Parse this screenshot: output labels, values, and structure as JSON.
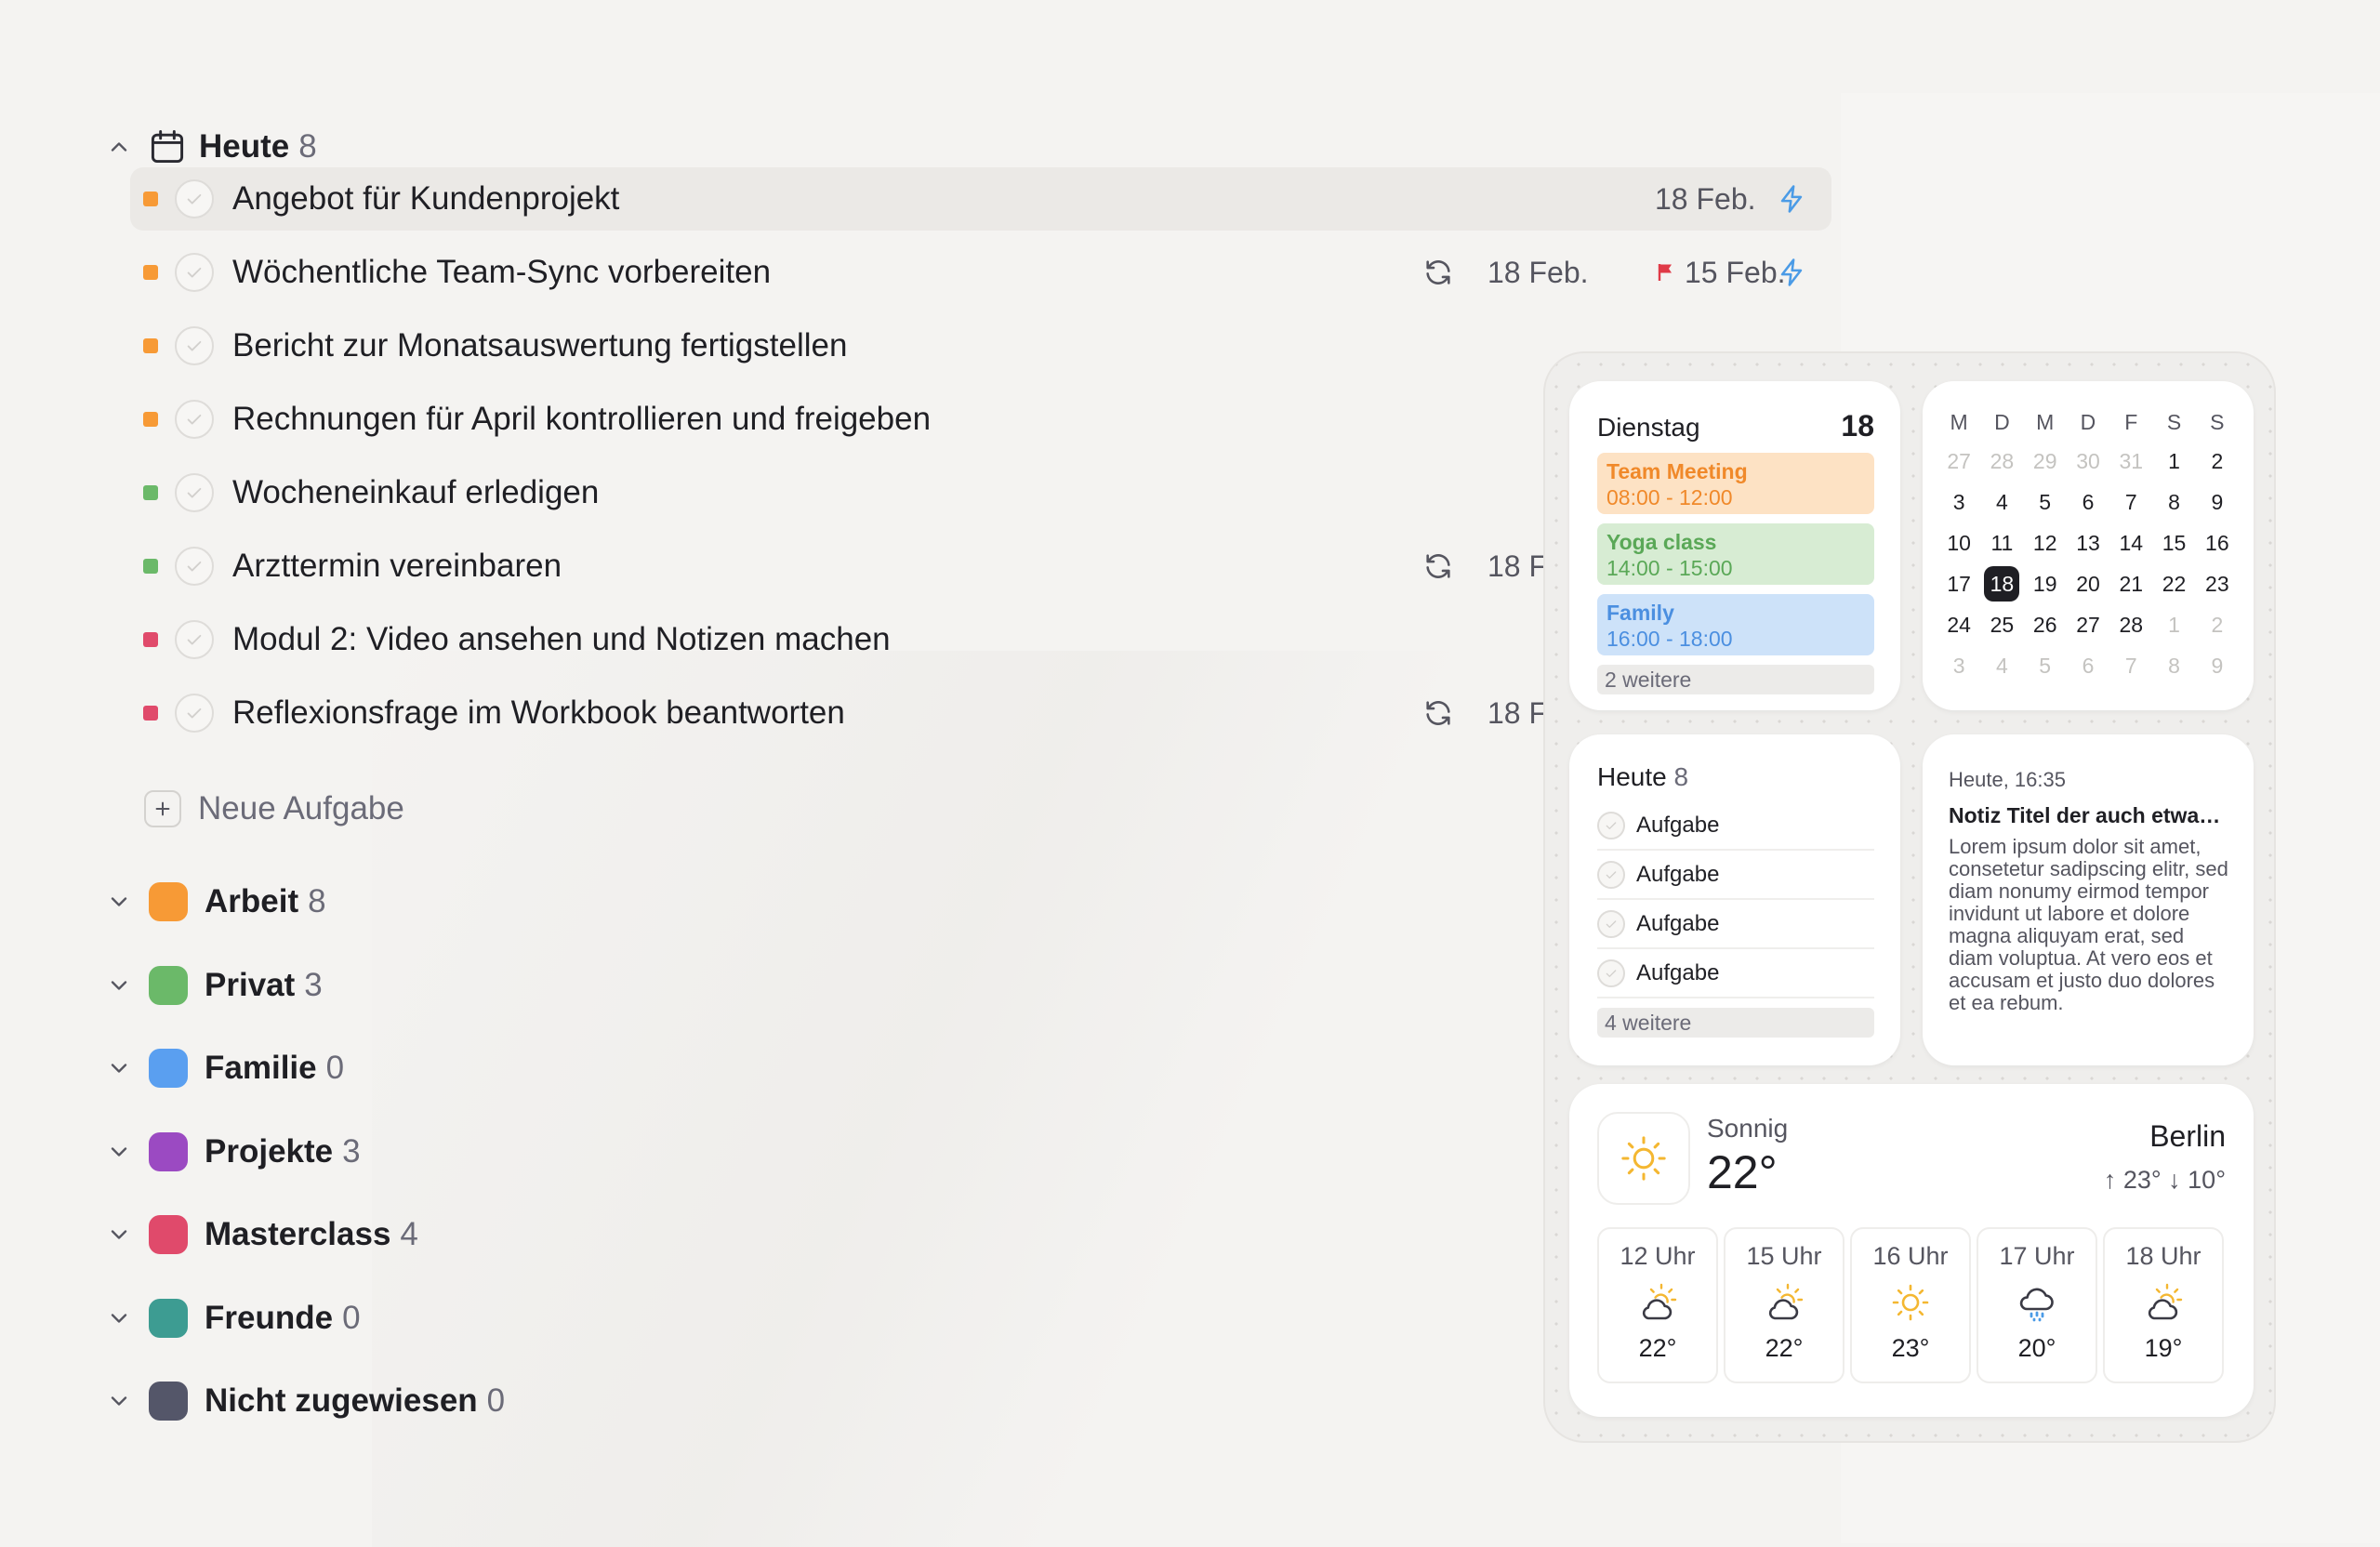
{
  "colors": {
    "orange": "#f79a36",
    "green": "#6bb969",
    "blue": "#5a9ff0",
    "purple": "#9b4ac2",
    "red": "#e04a6b",
    "teal": "#3d9c92",
    "slate": "#545669",
    "lightning": "#4b9be6",
    "flag": "#e03a47"
  },
  "today_group": {
    "title": "Heute",
    "count": "8",
    "tasks": [
      {
        "title": "Angebot für Kundenprojekt",
        "priority": "orange",
        "date": "18 Feb.",
        "icon": "lightning-icon"
      },
      {
        "title": "Wöchentliche Team-Sync vorbereiten",
        "priority": "orange",
        "repeat": true,
        "date": "18 Feb.",
        "deadline": "15 Feb.",
        "icon": "lightning-icon"
      },
      {
        "title": "Bericht zur Monatsauswertung fertigstellen",
        "priority": "orange"
      },
      {
        "title": "Rechnungen für April kontrollieren und freigeben",
        "priority": "orange"
      },
      {
        "title": "Wocheneinkauf erledigen",
        "priority": "green"
      },
      {
        "title": "Arzttermin vereinbaren",
        "priority": "green",
        "repeat": true,
        "date": "18 F"
      },
      {
        "title": "Modul 2: Video ansehen und Notizen machen",
        "priority": "red"
      },
      {
        "title": "Reflexionsfrage im Workbook beantworten",
        "priority": "red",
        "repeat": true,
        "date": "18 F"
      }
    ],
    "new_task_label": "Neue Aufgabe"
  },
  "groups": [
    {
      "title": "Arbeit",
      "count": "8",
      "color": "#f79a36"
    },
    {
      "title": "Privat",
      "count": "3",
      "color": "#6bb969"
    },
    {
      "title": "Familie",
      "count": "0",
      "color": "#5a9ff0"
    },
    {
      "title": "Projekte",
      "count": "3",
      "color": "#9b4ac2"
    },
    {
      "title": "Masterclass",
      "count": "4",
      "color": "#e04a6b"
    },
    {
      "title": "Freunde",
      "count": "0",
      "color": "#3d9c92"
    },
    {
      "title": "Nicht zugewiesen",
      "count": "0",
      "color": "#545669"
    }
  ],
  "widgets": {
    "day": {
      "weekday": "Dienstag",
      "day": "18",
      "events": [
        {
          "title": "Team Meeting",
          "time": "08:00 - 12:00",
          "bg": "#fde2c4",
          "fg": "#f0892a"
        },
        {
          "title": "Yoga class",
          "time": "14:00 - 15:00",
          "bg": "#d7ecd3",
          "fg": "#5aa857"
        },
        {
          "title": "Family",
          "time": "16:00 - 18:00",
          "bg": "#cde2f9",
          "fg": "#4b8fe0"
        }
      ],
      "more": "2 weitere"
    },
    "month": {
      "weekdays": [
        "M",
        "D",
        "M",
        "D",
        "F",
        "S",
        "S"
      ],
      "weeks": [
        [
          "27",
          "28",
          "29",
          "30",
          "31",
          "1",
          "2"
        ],
        [
          "3",
          "4",
          "5",
          "6",
          "7",
          "8",
          "9"
        ],
        [
          "10",
          "11",
          "12",
          "13",
          "14",
          "15",
          "16"
        ],
        [
          "17",
          "18",
          "19",
          "20",
          "21",
          "22",
          "23"
        ],
        [
          "24",
          "25",
          "26",
          "27",
          "28",
          "1",
          "2"
        ],
        [
          "3",
          "4",
          "5",
          "6",
          "7",
          "8",
          "9"
        ]
      ],
      "today": "18"
    },
    "tasks": {
      "title": "Heute",
      "count": "8",
      "items": [
        "Aufgabe",
        "Aufgabe",
        "Aufgabe",
        "Aufgabe"
      ],
      "more": "4 weitere"
    },
    "note": {
      "time": "Heute, 16:35",
      "title": "Notiz Titel der auch etwas länger ist",
      "body": "Lorem ipsum dolor sit amet, consetetur sadipscing elitr, sed diam nonumy eirmod tempor invidunt ut labore et dolore magna aliquyam erat, sed diam voluptua. At vero eos et accusam et justo duo dolores et ea rebum."
    },
    "weather": {
      "condition": "Sonnig",
      "temp": "22°",
      "city": "Berlin",
      "high_low": "↑ 23° ↓ 10°",
      "hours": [
        {
          "label": "12 Uhr",
          "icon": "sun-cloud-icon",
          "temp": "22°"
        },
        {
          "label": "15 Uhr",
          "icon": "sun-cloud-icon",
          "temp": "22°"
        },
        {
          "label": "16 Uhr",
          "icon": "sun-icon",
          "temp": "23°"
        },
        {
          "label": "17 Uhr",
          "icon": "rain-cloud-icon",
          "temp": "20°"
        },
        {
          "label": "18 Uhr",
          "icon": "sun-cloud-icon",
          "temp": "19°"
        }
      ]
    }
  }
}
